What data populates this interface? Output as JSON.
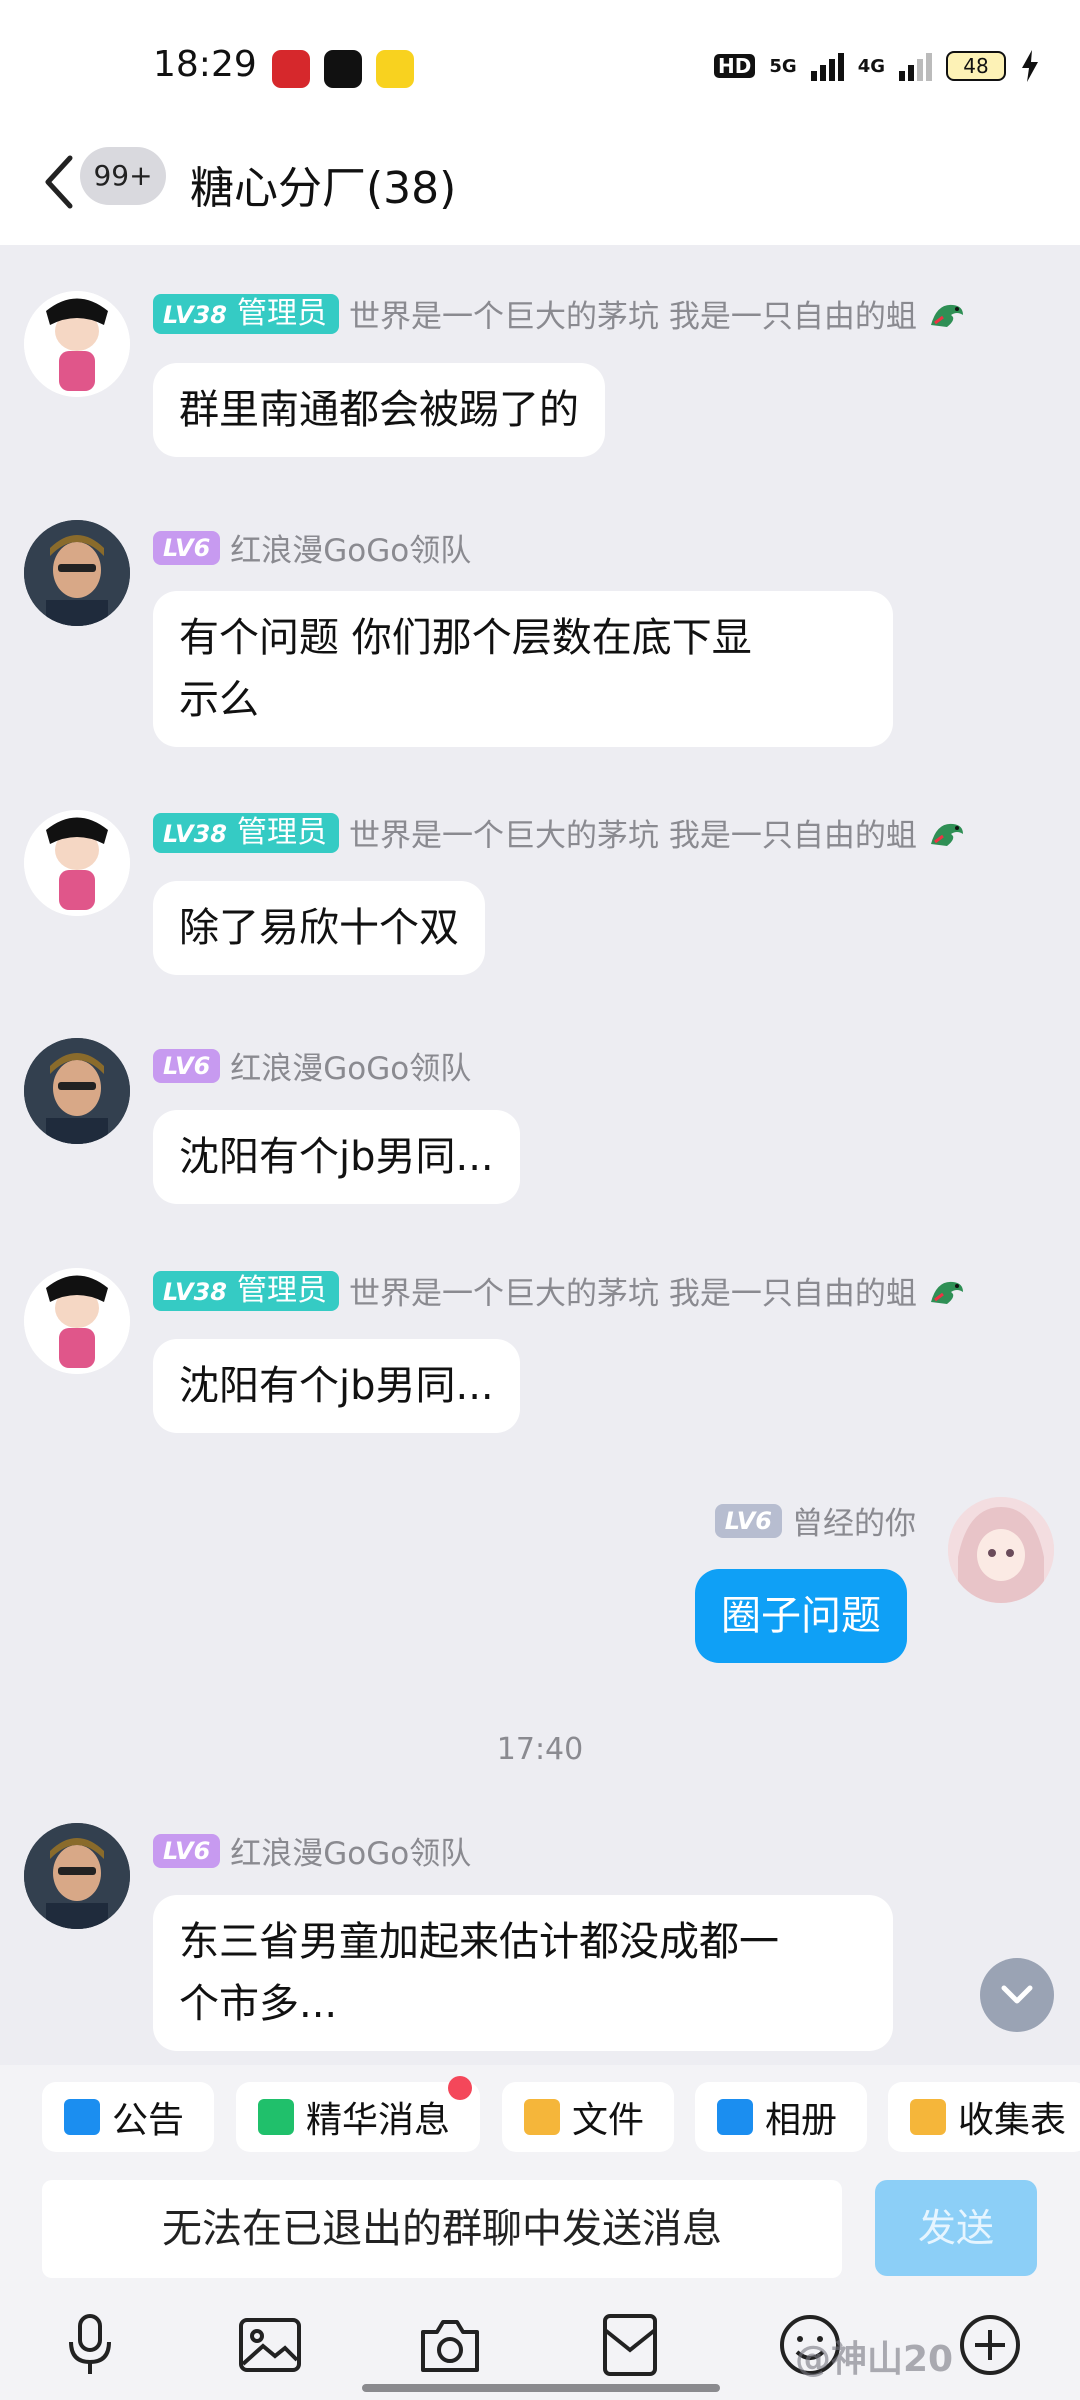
{
  "status_bar": {
    "time": "18:29",
    "battery": "48",
    "net1": "5G",
    "net2": "4G",
    "hd": "HD"
  },
  "header": {
    "unread_badge": "99+",
    "title": "糖心分厂(38)"
  },
  "messages": [
    {
      "sender": "世界是一个巨大的茅坑 我是一只自由的蛆",
      "level": "LV38",
      "role": "管理员",
      "text": "群里南通都会被踢了的"
    },
    {
      "sender": "红浪漫GoGo领队",
      "level": "LV6",
      "text_line1": "有个问题 你们那个层数在底下显",
      "text_line2": "示么"
    },
    {
      "sender": "世界是一个巨大的茅坑 我是一只自由的蛆",
      "level": "LV38",
      "role": "管理员",
      "text": "除了易欣十个双"
    },
    {
      "sender": "红浪漫GoGo领队",
      "level": "LV6",
      "text": "沈阳有个jb男同..."
    },
    {
      "sender": "世界是一个巨大的茅坑 我是一只自由的蛆",
      "level": "LV38",
      "role": "管理员",
      "text": "沈阳有个jb男同..."
    },
    {
      "sender": "曾经的你",
      "level": "LV6",
      "text": "圈子问题",
      "is_me": true
    },
    {
      "sender": "红浪漫GoGo领队",
      "level": "LV6",
      "text_line1": "东三省男童加起来估计都没成都一",
      "text_line2": "个市多..."
    }
  ],
  "timestamp": "17:40",
  "quick_actions": [
    "公告",
    "精华消息",
    "文件",
    "相册",
    "收集表"
  ],
  "input": {
    "placeholder": "无法在已退出的群聊中发送消息",
    "send_label": "发送"
  },
  "watermark": "@神山20",
  "colors": {
    "accent": "#0fa0f6",
    "admin_badge": "#35cbc4",
    "lv6": "#c79af0",
    "notice_dot": "#f4475a"
  }
}
